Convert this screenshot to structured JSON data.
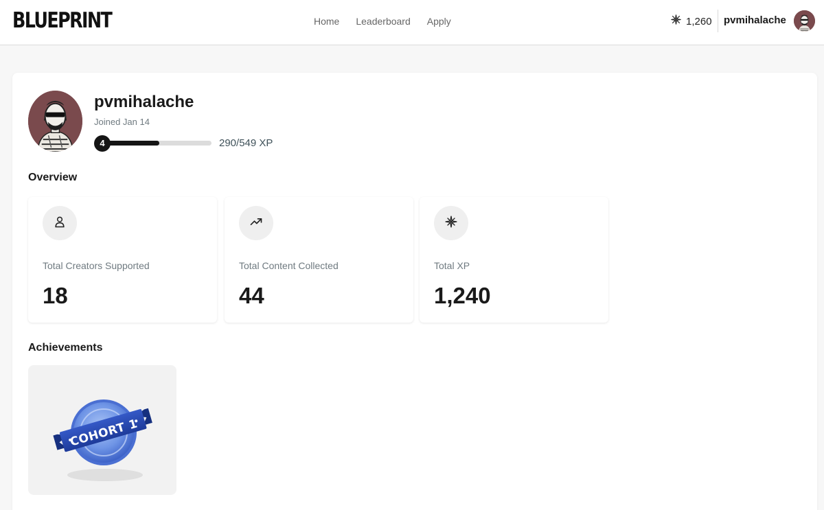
{
  "header": {
    "logo": "BLUEPRINT",
    "nav": [
      "Home",
      "Leaderboard",
      "Apply"
    ],
    "xp_balance": "1,260",
    "username": "pvmihalache"
  },
  "profile": {
    "username": "pvmihalache",
    "joined": "Joined Jan 14",
    "level": "4",
    "xp_progress": "290/549 XP",
    "xp_fraction": 0.528
  },
  "overview": {
    "title": "Overview",
    "stats": [
      {
        "icon": "user-icon",
        "label": "Total Creators Supported",
        "value": "18"
      },
      {
        "icon": "trending-up-icon",
        "label": "Total Content Collected",
        "value": "44"
      },
      {
        "icon": "sparkle-icon",
        "label": "Total XP",
        "value": "1,240"
      }
    ]
  },
  "achievements": {
    "title": "Achievements",
    "items": [
      {
        "label": "COHORT 1",
        "icon": "cohort-badge-icon"
      }
    ]
  },
  "colors": {
    "accent_dark": "#151515",
    "badge_blue": "#2b4fb8",
    "avatar_bg": "#7a4a4d"
  }
}
